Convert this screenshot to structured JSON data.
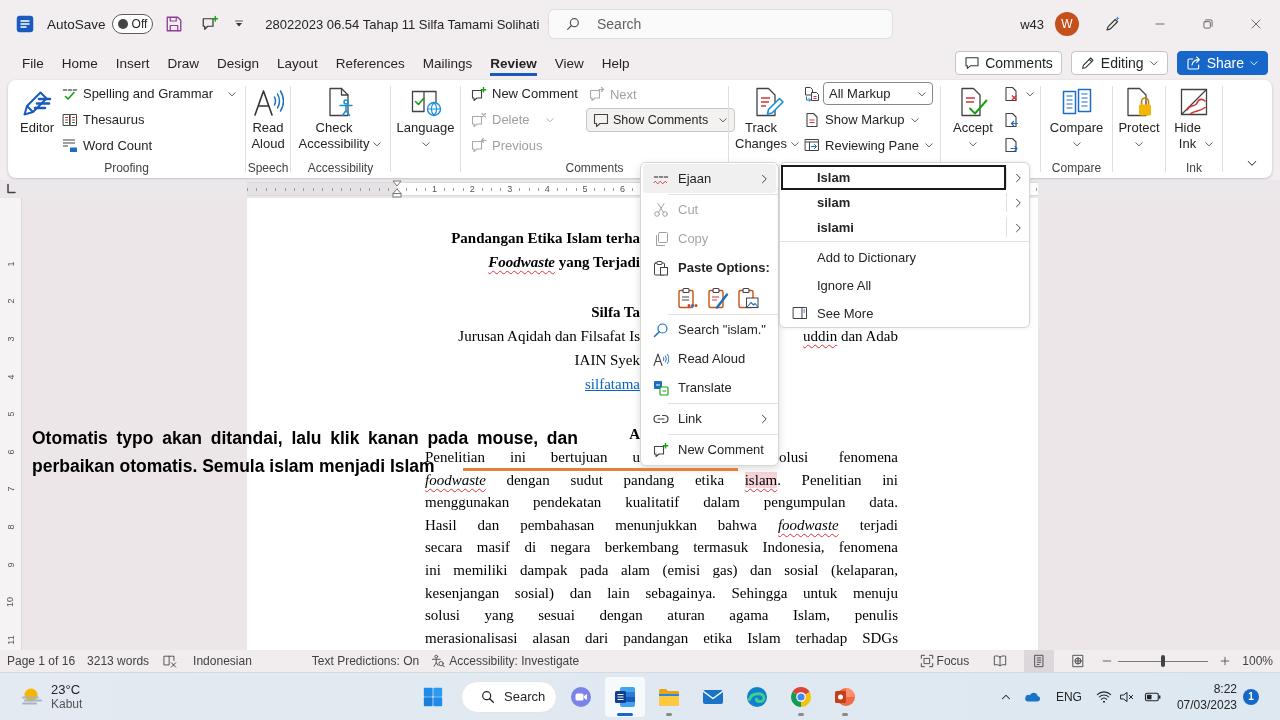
{
  "title_bar": {
    "autosave": {
      "label": "AutoSave",
      "state_text": "Off",
      "on": false
    },
    "document_title": "28022023 06.54 Tahap 11 Silfa Tamami Solihati",
    "search": {
      "placeholder": "Search"
    },
    "account": {
      "name": "w43",
      "initial": "W"
    }
  },
  "menu_tabs": [
    {
      "label": "File",
      "selected": false
    },
    {
      "label": "Home",
      "selected": false
    },
    {
      "label": "Insert",
      "selected": false
    },
    {
      "label": "Draw",
      "selected": false
    },
    {
      "label": "Design",
      "selected": false
    },
    {
      "label": "Layout",
      "selected": false
    },
    {
      "label": "References",
      "selected": false
    },
    {
      "label": "Mailings",
      "selected": false
    },
    {
      "label": "Review",
      "selected": true
    },
    {
      "label": "View",
      "selected": false
    },
    {
      "label": "Help",
      "selected": false
    }
  ],
  "header_buttons": {
    "comments": "Comments",
    "editing": "Editing",
    "share": "Share"
  },
  "ribbon": {
    "proofing": {
      "label": "Proofing",
      "editor": "Editor",
      "spelling": "Spelling and Grammar",
      "thesaurus": "Thesaurus",
      "word_count": "Word Count"
    },
    "speech": {
      "label": "Speech",
      "read_aloud": "Read Aloud"
    },
    "accessibility": {
      "label": "Accessibility",
      "check": "Check Accessibility"
    },
    "language": {
      "button": "Language"
    },
    "comments": {
      "label": "Comments",
      "new_comment": {
        "label": "New Comment",
        "disabled": false
      },
      "delete": {
        "label": "Delete",
        "disabled": true
      },
      "previous": {
        "label": "Previous",
        "disabled": true
      },
      "next": {
        "label": "Next",
        "disabled": true
      },
      "show_comments": "Show Comments"
    },
    "tracking": {
      "track_changes": "Track Changes",
      "markup": "All Markup",
      "show_markup": "Show Markup",
      "reviewing_pane": "Reviewing Pane"
    },
    "changes": {
      "accept": "Accept"
    },
    "compare": {
      "label": "Compare",
      "button": "Compare"
    },
    "protect": {
      "button": "Protect"
    },
    "ink": {
      "label": "Ink",
      "hide_ink": "Hide Ink"
    }
  },
  "ruler": {
    "numbers": [
      "1",
      "2",
      "3",
      "4",
      "5",
      "6"
    ]
  },
  "vertical_ruler": {
    "numbers": [
      "1",
      "2",
      "3",
      "4",
      "5",
      "6",
      "7",
      "8",
      "9",
      "10",
      "11"
    ]
  },
  "document": {
    "sections": [
      [
        {
          "kind": "title",
          "lines": [
            {
              "left": [
                {
                  "text": "Pandangan Etika Islam terha",
                  "kind": "plain"
                }
              ]
            },
            {
              "left": [
                {
                  "text": "Foodwaste",
                  "kind": "term"
                },
                {
                  "text": " yang Terjadi",
                  "kind": "plain"
                }
              ]
            }
          ]
        }
      ],
      [
        {
          "kind": "name",
          "lines": [
            {
              "left": [
                {
                  "text": "Silfa Ta",
                  "kind": "plain"
                }
              ]
            }
          ]
        },
        {
          "kind": "text",
          "lines": [
            {
              "left": [
                {
                  "text": "Jurusan Aqidah dan Filsafat Is",
                  "kind": "plain"
                }
              ],
              "right": [
                {
                  "text": "uddin",
                  "kind": "typo"
                },
                {
                  "text": " dan Adab",
                  "kind": "plain"
                }
              ]
            }
          ]
        },
        {
          "kind": "text",
          "lines": [
            {
              "left": [
                {
                  "text": "IAIN Syek",
                  "kind": "plain"
                }
              ]
            }
          ]
        },
        {
          "kind": "link",
          "lines": [
            {
              "left": [
                {
                  "text": "silfatama",
                  "kind": "plain"
                }
              ]
            }
          ]
        }
      ],
      [
        {
          "kind": "heading",
          "lines": [
            {
              "left": [
                {
                  "text": "A",
                  "kind": "plain"
                }
              ]
            }
          ]
        },
        {
          "kind": "paragraph",
          "lines": [
            {
              "left": [
                {
                  "text": "Penelitian ini bertujuan u",
                  "kind": "plain"
                }
              ],
              "right": [
                {
                  "text": "olusi fenomena",
                  "kind": "plain"
                }
              ]
            },
            {
              "parts": [
                {
                  "text": "foodwaste",
                  "kind": "term"
                },
                {
                  "text": " dengan sudut pandang etika ",
                  "kind": "plain"
                },
                {
                  "text": "islam",
                  "kind": "selected"
                },
                {
                  "text": ". Penelitian ini",
                  "kind": "plain"
                }
              ]
            },
            {
              "parts": [
                {
                  "text": "menggunakan pendekatan kualitatif dalam pengumpulan data.",
                  "kind": "plain"
                }
              ]
            },
            {
              "parts": [
                {
                  "text": "Hasil dan pembahasan menunjukkan bahwa ",
                  "kind": "plain"
                },
                {
                  "text": "foodwaste",
                  "kind": "term"
                },
                {
                  "text": " terjadi",
                  "kind": "plain"
                }
              ]
            },
            {
              "parts": [
                {
                  "text": "secara masif di negara berkembang termasuk Indonesia, fenomena",
                  "kind": "plain"
                }
              ]
            },
            {
              "parts": [
                {
                  "text": "ini memiliki dampak pada alam (emisi gas) dan sosial (kelaparan,",
                  "kind": "plain"
                }
              ]
            },
            {
              "parts": [
                {
                  "text": "kesenjangan sosial) dan lain sebagainya. Sehingga untuk menuju",
                  "kind": "plain"
                }
              ]
            },
            {
              "parts": [
                {
                  "text": "solusi yang sesuai dengan aturan agama Islam, penulis",
                  "kind": "plain"
                }
              ]
            },
            {
              "parts": [
                {
                  "text": "merasionalisasi alasan dari pandangan etika Islam terhadap SDGs",
                  "kind": "plain"
                }
              ]
            }
          ]
        }
      ]
    ]
  },
  "annotation": {
    "lines": [
      "Otomatis typo akan ditandai, lalu klik kanan pada mouse, dan",
      "perbaikan otomatis. Semula islam menjadi Islam"
    ]
  },
  "context_menu": {
    "sections": [
      [
        {
          "kind": "item",
          "label": "Ejaan",
          "disabled": false,
          "submenu": true,
          "expanded": true
        }
      ],
      [
        {
          "kind": "item",
          "label": "Cut",
          "disabled": true,
          "submenu": false,
          "expanded": false
        },
        {
          "kind": "item",
          "label": "Copy",
          "disabled": true,
          "submenu": false,
          "expanded": false
        },
        {
          "kind": "heading",
          "label": "Paste Options:"
        },
        {
          "kind": "paste"
        }
      ],
      [
        {
          "kind": "item",
          "label": "Search \"islam.\"",
          "disabled": false,
          "submenu": false,
          "expanded": false
        },
        {
          "kind": "item",
          "label": "Read Aloud",
          "disabled": false,
          "submenu": false,
          "expanded": false
        },
        {
          "kind": "item",
          "label": "Translate",
          "disabled": false,
          "submenu": false,
          "expanded": false
        }
      ],
      [
        {
          "kind": "item",
          "label": "Link",
          "disabled": false,
          "submenu": true,
          "expanded": false
        }
      ],
      [
        {
          "kind": "item",
          "label": "New Comment",
          "disabled": false,
          "submenu": false,
          "expanded": false
        }
      ]
    ]
  },
  "spelling_submenu": {
    "suggestions": [
      {
        "label": "Islam",
        "selected": true
      },
      {
        "label": "silam",
        "selected": false
      },
      {
        "label": "islami",
        "selected": false
      }
    ],
    "actions": [
      "Add to Dictionary",
      "Ignore All",
      "See More"
    ]
  },
  "status_bar": {
    "page": "Page 1 of 16",
    "words": "3213 words",
    "language": "Indonesian",
    "predictions": "Text Predictions: On",
    "accessibility": "Accessibility: Investigate",
    "focus": "Focus",
    "views": [
      {
        "selected": false
      },
      {
        "selected": true
      },
      {
        "selected": false
      }
    ],
    "zoom": {
      "level": 0.5,
      "label": "100%"
    }
  },
  "taskbar": {
    "weather": {
      "temperature": "23°C",
      "condition": "Kabut"
    },
    "search": "Search",
    "apps": [
      {
        "selected": false,
        "running": false
      },
      {
        "selected": true,
        "running": true
      },
      {
        "selected": false,
        "running": true
      },
      {
        "selected": false,
        "running": false
      },
      {
        "selected": false,
        "running": false
      },
      {
        "selected": false,
        "running": true
      },
      {
        "selected": false,
        "running": true
      }
    ],
    "language": "ENG",
    "time": "8:22",
    "date": "07/03/2023",
    "notifications": "1"
  }
}
